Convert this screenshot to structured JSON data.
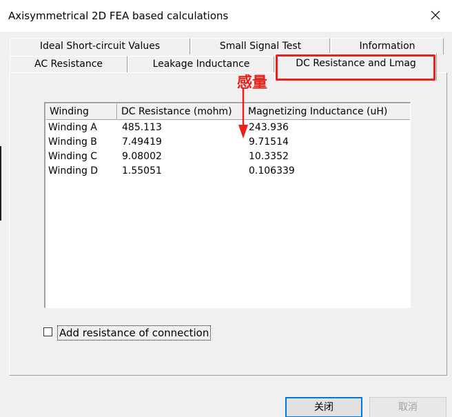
{
  "window": {
    "title": "Axisymmetrical 2D FEA based calculations"
  },
  "tabs": {
    "back_row": [
      {
        "label": "Ideal Short-circuit Values"
      },
      {
        "label": "Small Signal Test"
      },
      {
        "label": "Information"
      }
    ],
    "front_row": [
      {
        "label": "AC Resistance"
      },
      {
        "label": "Leakage Inductance"
      },
      {
        "label": "DC Resistance and Lmag",
        "active": true
      }
    ]
  },
  "annotation": {
    "label": "感量",
    "color": "#e8221b"
  },
  "table": {
    "columns": [
      "Winding",
      "DC Resistance (mohm)",
      "Magnetizing Inductance (uH)"
    ],
    "rows": [
      [
        "Winding A",
        "485.113",
        "243.936"
      ],
      [
        "Winding B",
        "7.49419",
        "9.71514"
      ],
      [
        "Winding C",
        "9.08002",
        "10.3352"
      ],
      [
        "Winding D",
        "1.55051",
        "0.106339"
      ]
    ]
  },
  "options": {
    "add_resistance_label": "Add resistance of connection",
    "add_resistance_checked": false
  },
  "buttons": {
    "ok_label": "关闭",
    "cancel_label": "取消"
  }
}
